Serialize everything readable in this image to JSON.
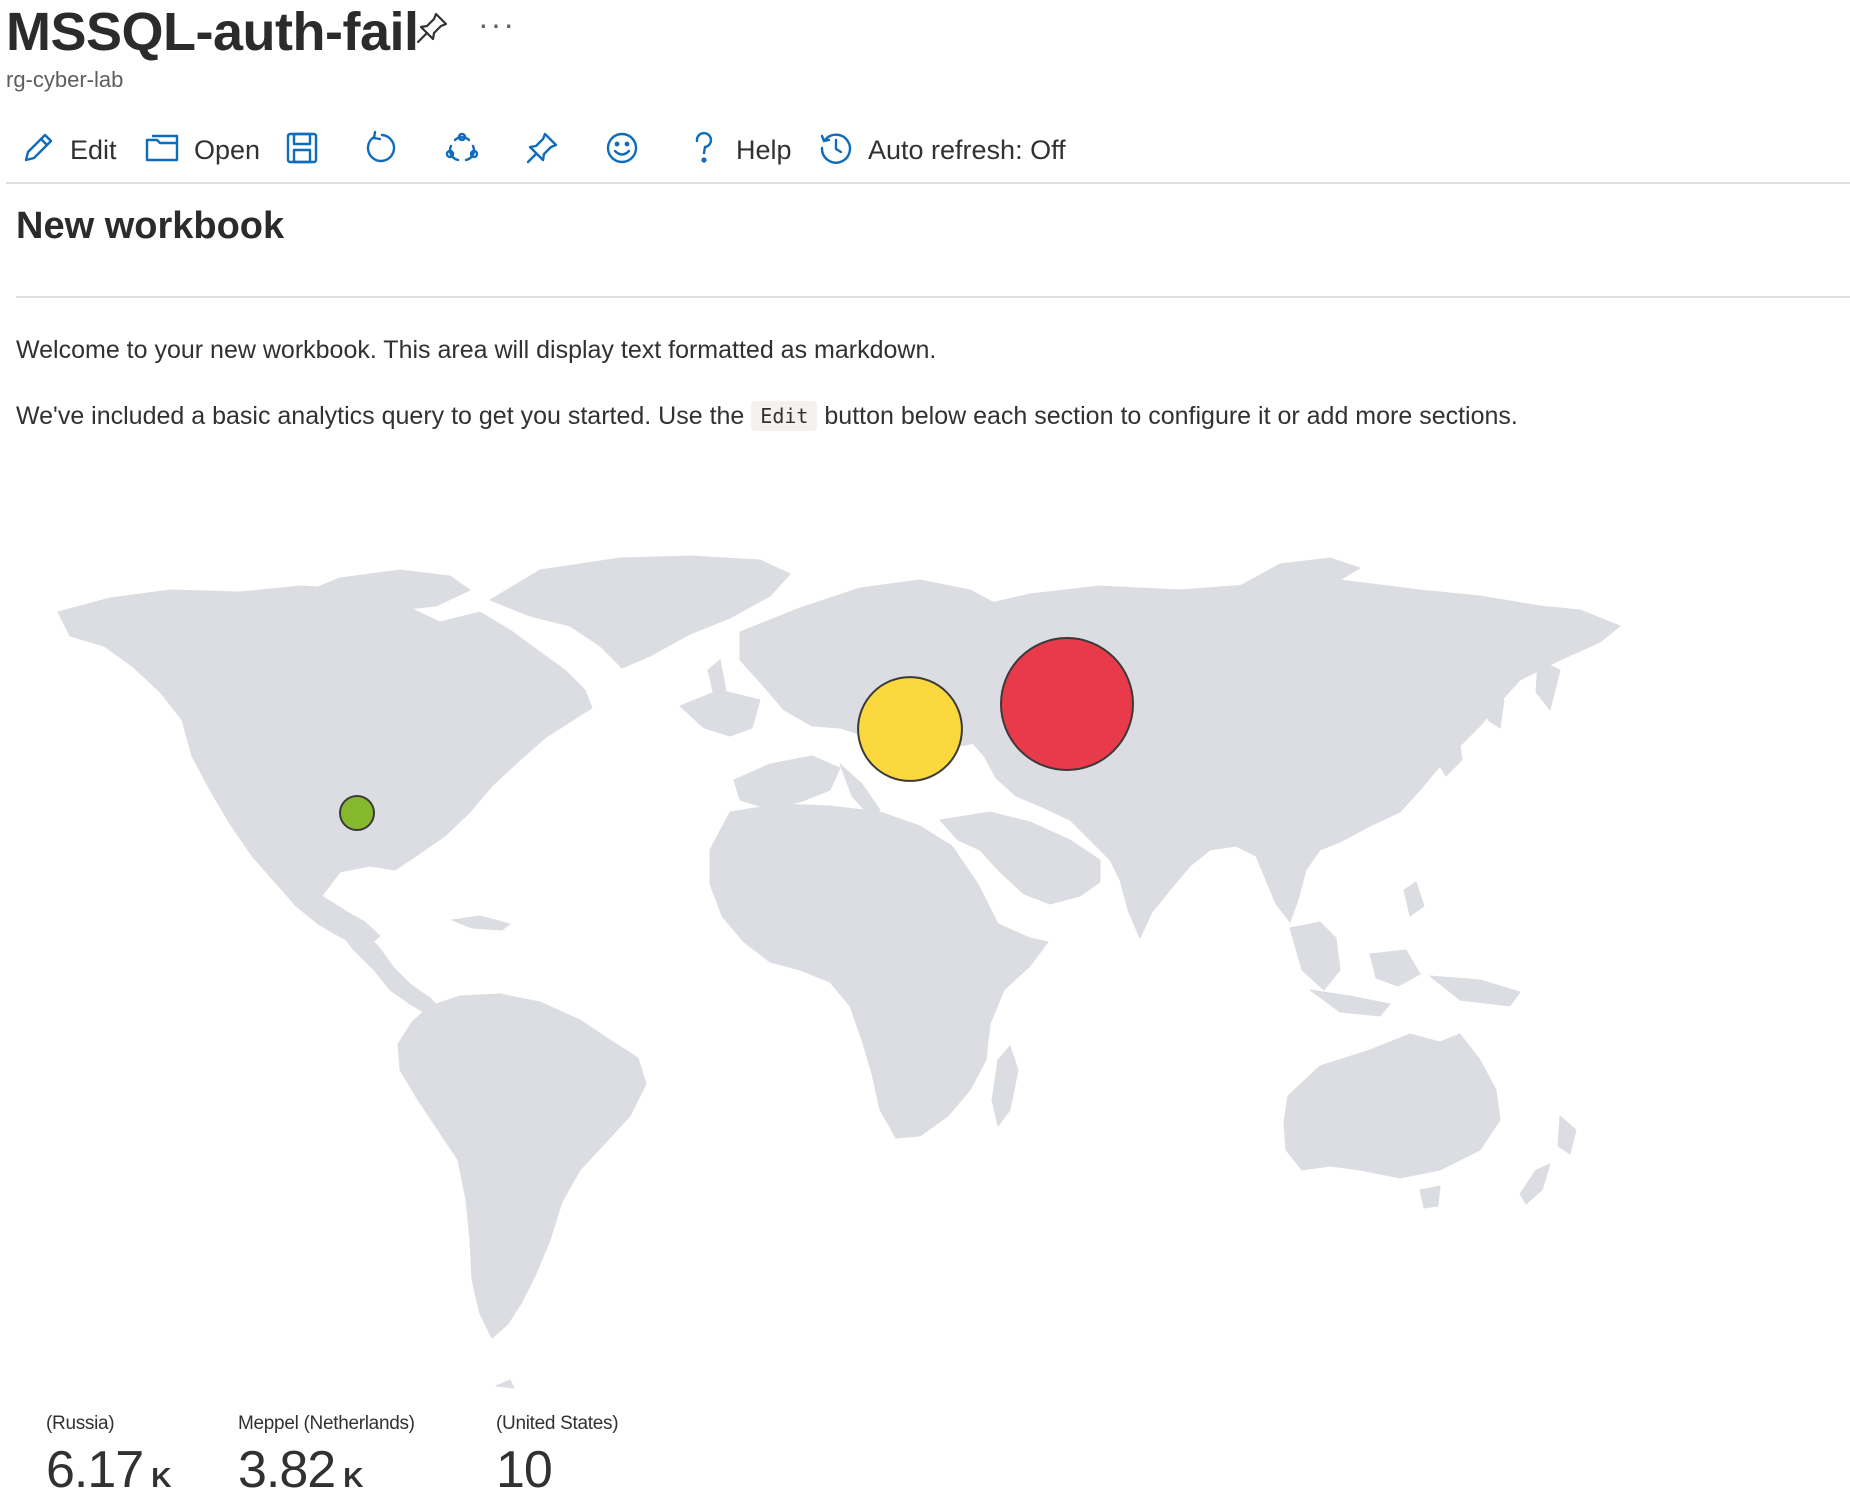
{
  "header": {
    "title": "MSSQL-auth-fail",
    "more_label": "···",
    "subtitle": "rg-cyber-lab"
  },
  "toolbar": {
    "edit_label": "Edit",
    "open_label": "Open",
    "help_label": "Help",
    "auto_refresh_label": "Auto refresh: Off",
    "icons": [
      "edit-icon",
      "open-icon",
      "save-icon",
      "refresh-icon",
      "share-icon",
      "pin-icon",
      "feedback-icon",
      "help-icon",
      "history-icon"
    ]
  },
  "workbook": {
    "title": "New workbook",
    "markdown": {
      "line1": "Welcome to your new workbook. This area will display text formatted as markdown.",
      "line2_before": "We've included a basic analytics query to get you started. Use the",
      "line2_code": "Edit",
      "line2_after": "button below each section to configure it or add more sections."
    }
  },
  "map": {
    "land_color": "#dcdde2",
    "bubbles": [
      {
        "name": "Russia",
        "value": 6170,
        "color": "#e83a4a"
      },
      {
        "name": "Meppel (Netherlands)",
        "value": 3820,
        "color": "#fbd83e"
      },
      {
        "name": "United States",
        "value": 10,
        "color": "#86b92d"
      }
    ]
  },
  "tiles": [
    {
      "label": "(Russia)",
      "value": "6.17",
      "unit": "K"
    },
    {
      "label": "Meppel (Netherlands)",
      "value": "3.82",
      "unit": "K"
    },
    {
      "label": "(United States)",
      "value": "10",
      "unit": ""
    }
  ]
}
